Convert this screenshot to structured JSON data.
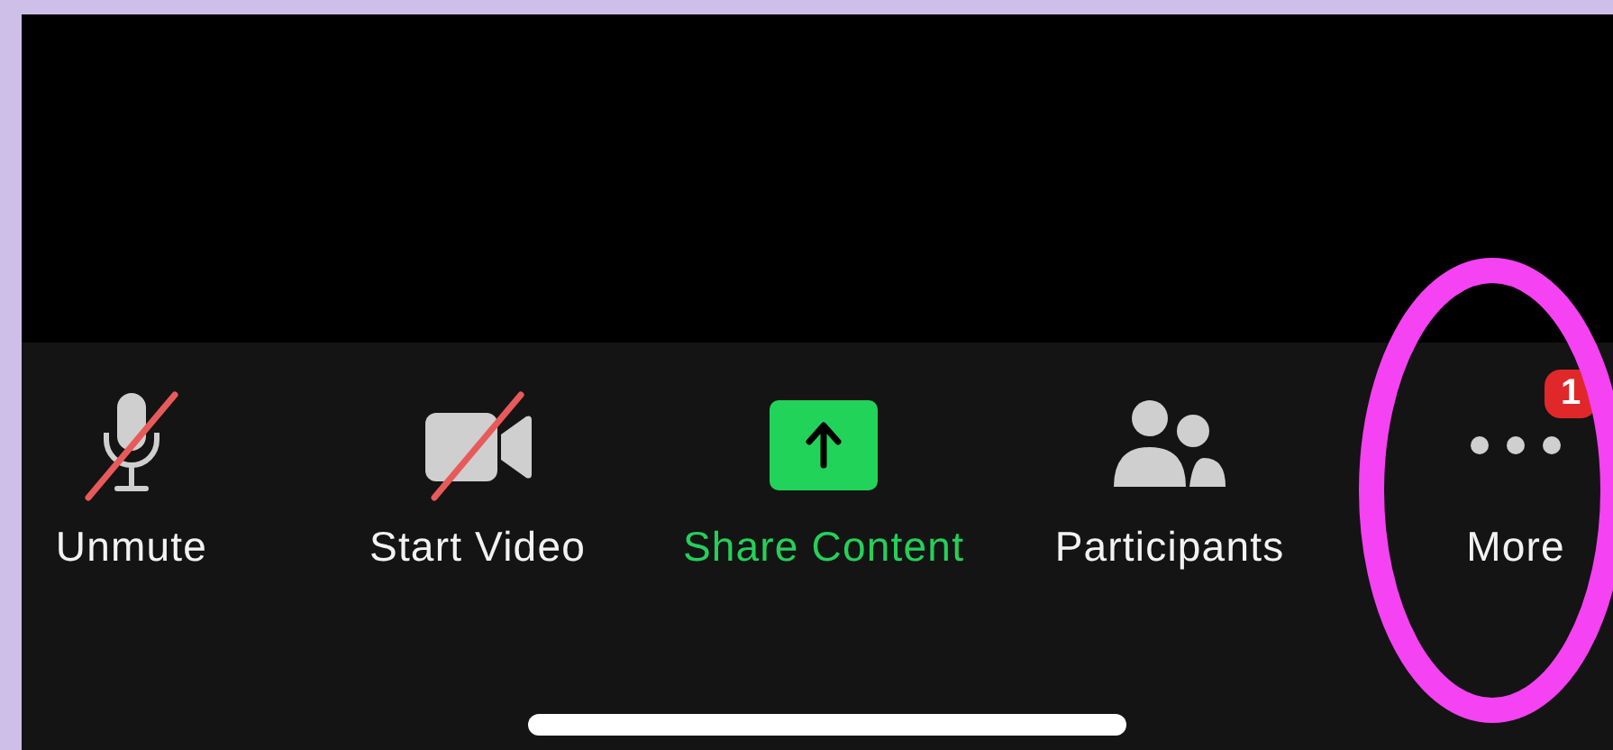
{
  "toolbar": {
    "buttons": [
      {
        "kind": "mic",
        "label": "Unmute",
        "off": true,
        "highlighted": false
      },
      {
        "kind": "video",
        "label": "Start Video",
        "off": true,
        "highlighted": false
      },
      {
        "kind": "share",
        "label": "Share Content",
        "off": false,
        "highlighted": true
      },
      {
        "kind": "people",
        "label": "Participants",
        "off": false,
        "highlighted": false
      },
      {
        "kind": "more",
        "label": "More",
        "off": false,
        "highlighted": false,
        "badge": "1"
      }
    ]
  }
}
